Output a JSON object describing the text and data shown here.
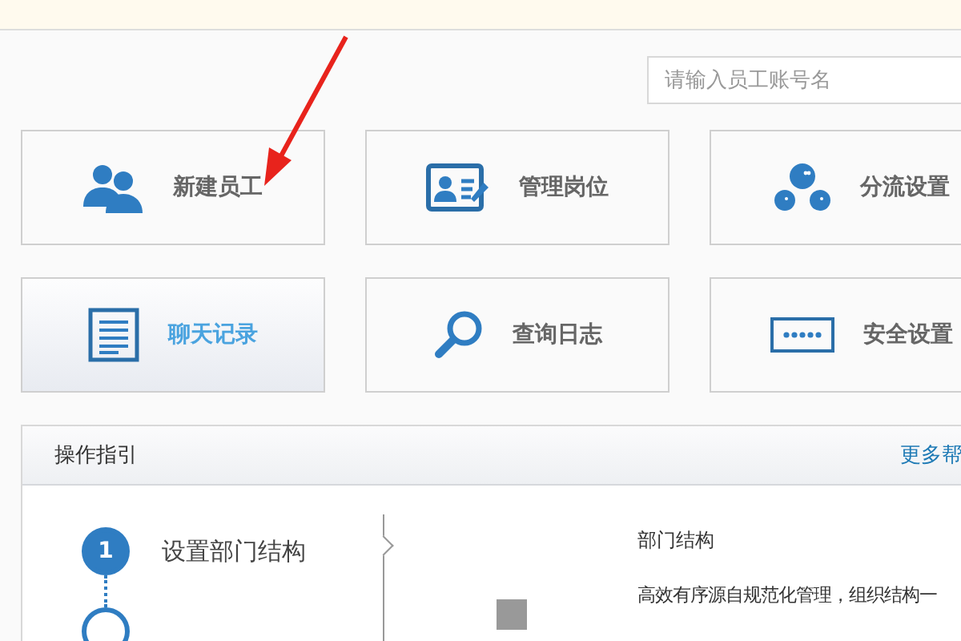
{
  "search": {
    "placeholder": "请输入员工账号名"
  },
  "tiles": [
    {
      "label": "新建员工",
      "kind": "people",
      "selected": false
    },
    {
      "label": "管理岗位",
      "kind": "card",
      "selected": false
    },
    {
      "label": "分流设置",
      "kind": "blobs",
      "selected": false
    },
    {
      "label": "聊天记录",
      "kind": "document",
      "selected": true
    },
    {
      "label": "查询日志",
      "kind": "magnifier",
      "selected": false
    },
    {
      "label": "安全设置",
      "kind": "password",
      "selected": false
    }
  ],
  "guide": {
    "title": "操作指引",
    "more_link": "更多帮",
    "steps": [
      {
        "number": "1",
        "label": "设置部门结构",
        "selected": true
      },
      {
        "selected": false
      }
    ],
    "detail": {
      "heading": "部门结构",
      "text": "高效有序源自规范化管理，组织结构一"
    }
  },
  "annotation": {
    "kind": "arrow"
  }
}
